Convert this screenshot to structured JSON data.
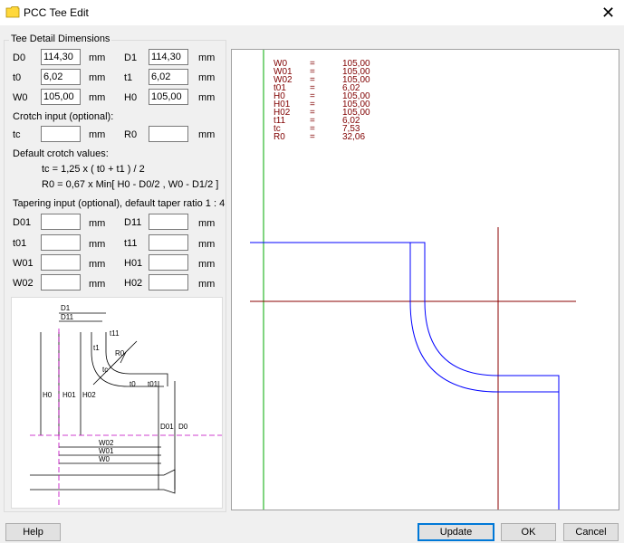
{
  "window": {
    "title": "PCC Tee Edit",
    "close_glyph": "✕"
  },
  "group": {
    "title": "Tee Detail Dimensions"
  },
  "dims": {
    "D0": {
      "label": "D0",
      "value": "114,30",
      "unit": "mm"
    },
    "D1": {
      "label": "D1",
      "value": "114,30",
      "unit": "mm"
    },
    "t0": {
      "label": "t0",
      "value": "6,02",
      "unit": "mm"
    },
    "t1": {
      "label": "t1",
      "value": "6,02",
      "unit": "mm"
    },
    "W0": {
      "label": "W0",
      "value": "105,00",
      "unit": "mm"
    },
    "H0": {
      "label": "H0",
      "value": "105,00",
      "unit": "mm"
    }
  },
  "crotch": {
    "heading": "Crotch input (optional):",
    "tc": {
      "label": "tc",
      "value": "",
      "unit": "mm"
    },
    "R0": {
      "label": "R0",
      "value": "",
      "unit": "mm"
    }
  },
  "defaults": {
    "heading": "Default crotch values:",
    "formula_tc": "tc = 1,25 x ( t0 + t1 ) / 2",
    "formula_r0": "R0 = 0,67 x Min[ H0 - D0/2 , W0 - D1/2 ]"
  },
  "tapering": {
    "heading": "Tapering input (optional), default taper ratio 1 : 4",
    "D01": {
      "label": "D01",
      "value": "",
      "unit": "mm"
    },
    "D11": {
      "label": "D11",
      "value": "",
      "unit": "mm"
    },
    "t01": {
      "label": "t01",
      "value": "",
      "unit": "mm"
    },
    "t11": {
      "label": "t11",
      "value": "",
      "unit": "mm"
    },
    "W01": {
      "label": "W01",
      "value": "",
      "unit": "mm"
    },
    "H01": {
      "label": "H01",
      "value": "",
      "unit": "mm"
    },
    "W02": {
      "label": "W02",
      "value": "",
      "unit": "mm"
    },
    "H02": {
      "label": "H02",
      "value": "",
      "unit": "mm"
    }
  },
  "sketch_labels": {
    "D1": "D1",
    "D11": "D11",
    "t11": "t11",
    "t1": "t1",
    "R0": "R0",
    "tc": "tc",
    "t0": "t0",
    "t01": "t01",
    "H0": "H0",
    "H01": "H01",
    "H02": "H02",
    "D01": "D01",
    "D0": "D0",
    "W02": "W02",
    "W01": "W01",
    "W0": "W0"
  },
  "results": [
    {
      "name": "W0",
      "eq": "=",
      "value": "105,00"
    },
    {
      "name": "W01",
      "eq": "=",
      "value": "105,00"
    },
    {
      "name": "W02",
      "eq": "=",
      "value": "105,00"
    },
    {
      "name": "t01",
      "eq": "=",
      "value": "6,02"
    },
    {
      "name": "H0",
      "eq": "=",
      "value": "105,00"
    },
    {
      "name": "H01",
      "eq": "=",
      "value": "105,00"
    },
    {
      "name": "H02",
      "eq": "=",
      "value": "105,00"
    },
    {
      "name": "t11",
      "eq": "=",
      "value": "6,02"
    },
    {
      "name": "tc",
      "eq": "=",
      "value": "7,53"
    },
    {
      "name": "R0",
      "eq": "=",
      "value": "32,06"
    }
  ],
  "colors": {
    "result_text": "#800000",
    "outline": "#0000ff",
    "crosshair": "#8b0000",
    "guide": "#00aa00"
  },
  "buttons": {
    "help": "Help",
    "update": "Update",
    "ok": "OK",
    "cancel": "Cancel"
  }
}
